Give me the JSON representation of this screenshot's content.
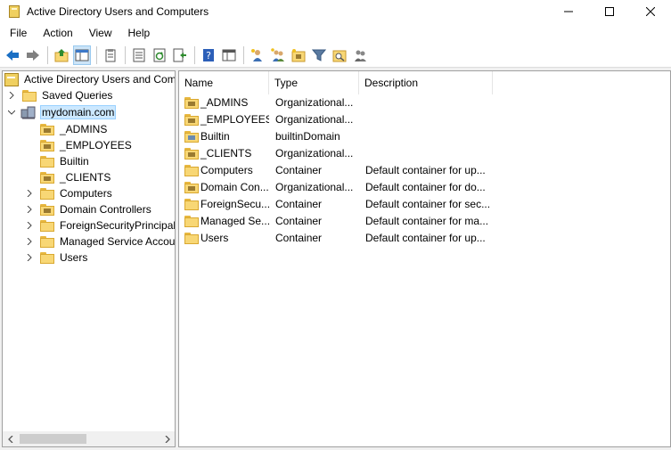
{
  "window": {
    "title": "Active Directory Users and Computers",
    "controls": [
      "minimize-icon",
      "maximize-icon",
      "close-icon"
    ]
  },
  "menu": [
    {
      "label": "File"
    },
    {
      "label": "Action"
    },
    {
      "label": "View"
    },
    {
      "label": "Help"
    }
  ],
  "toolbar": {
    "buttons": [
      "back-icon",
      "forward-icon",
      "up-folder-icon",
      "show-hide-tree-icon",
      "clipboard-icon",
      "properties-icon",
      "refresh-icon",
      "export-list-icon",
      "help-icon",
      "console-icon",
      "new-user-icon",
      "new-group-icon",
      "new-ou-icon",
      "filter-icon",
      "find-icon",
      "add-to-group-icon"
    ]
  },
  "tree": {
    "root": "Active Directory Users and Com",
    "saved_queries": "Saved Queries",
    "domain": "mydomain.com",
    "children": [
      {
        "label": "_ADMINS",
        "icon": "ou-icon",
        "expandable": false
      },
      {
        "label": "_EMPLOYEES",
        "icon": "ou-icon",
        "expandable": false
      },
      {
        "label": "Builtin",
        "icon": "folder-icon",
        "expandable": false
      },
      {
        "label": "_CLIENTS",
        "icon": "ou-icon",
        "expandable": false
      },
      {
        "label": "Computers",
        "icon": "folder-icon",
        "expandable": true
      },
      {
        "label": "Domain Controllers",
        "icon": "ou-icon",
        "expandable": true
      },
      {
        "label": "ForeignSecurityPrincipals",
        "icon": "folder-icon",
        "expandable": true
      },
      {
        "label": "Managed Service Accour",
        "icon": "folder-icon",
        "expandable": true
      },
      {
        "label": "Users",
        "icon": "folder-icon",
        "expandable": true
      }
    ]
  },
  "list": {
    "columns": [
      "Name",
      "Type",
      "Description"
    ],
    "rows": [
      {
        "name": "_ADMINS",
        "type": "Organizational...",
        "description": "",
        "icon": "ou-icon"
      },
      {
        "name": "_EMPLOYEES",
        "type": "Organizational...",
        "description": "",
        "icon": "ou-icon"
      },
      {
        "name": "Builtin",
        "type": "builtinDomain",
        "description": "",
        "icon": "builtin-icon"
      },
      {
        "name": "_CLIENTS",
        "type": "Organizational...",
        "description": "",
        "icon": "ou-icon"
      },
      {
        "name": "Computers",
        "type": "Container",
        "description": "Default container for up...",
        "icon": "folder-icon"
      },
      {
        "name": "Domain Con...",
        "type": "Organizational...",
        "description": "Default container for do...",
        "icon": "ou-icon"
      },
      {
        "name": "ForeignSecu...",
        "type": "Container",
        "description": "Default container for sec...",
        "icon": "folder-icon"
      },
      {
        "name": "Managed Se...",
        "type": "Container",
        "description": "Default container for ma...",
        "icon": "folder-icon"
      },
      {
        "name": "Users",
        "type": "Container",
        "description": "Default container for up...",
        "icon": "folder-icon"
      }
    ]
  },
  "colors": {
    "selection": "#cce8ff",
    "folder": "#f8d775",
    "accent": "#1a6fc4"
  }
}
